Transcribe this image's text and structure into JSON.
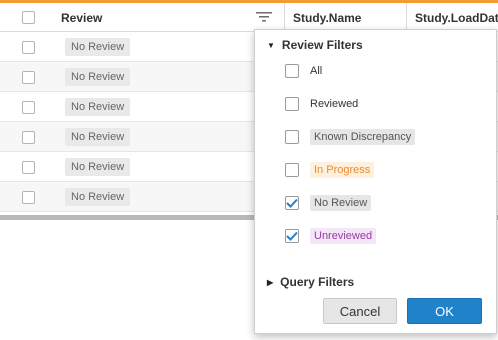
{
  "colors": {
    "accent": "#f39c34",
    "primary_button": "#2082c9",
    "checkbox_check": "#2280c3"
  },
  "header": {
    "review": "Review",
    "study_name": "Study.Name",
    "study_loaddate": "Study.LoadDate",
    "filter_icon": "filter-icon"
  },
  "rows": [
    {
      "review": "No Review"
    },
    {
      "review": "No Review"
    },
    {
      "review": "No Review"
    },
    {
      "review": "No Review"
    },
    {
      "review": "No Review"
    },
    {
      "review": "No Review"
    }
  ],
  "popup": {
    "review_filters": "Review Filters",
    "options": [
      {
        "label": "All",
        "checked": false
      },
      {
        "label": "Reviewed",
        "checked": false
      },
      {
        "label": "Known Discrepancy",
        "checked": false
      },
      {
        "label": "In Progress",
        "checked": false
      },
      {
        "label": "No Review",
        "checked": true
      },
      {
        "label": "Unreviewed",
        "checked": true
      }
    ],
    "query_filters": "Query Filters",
    "cancel": "Cancel",
    "ok": "OK"
  }
}
